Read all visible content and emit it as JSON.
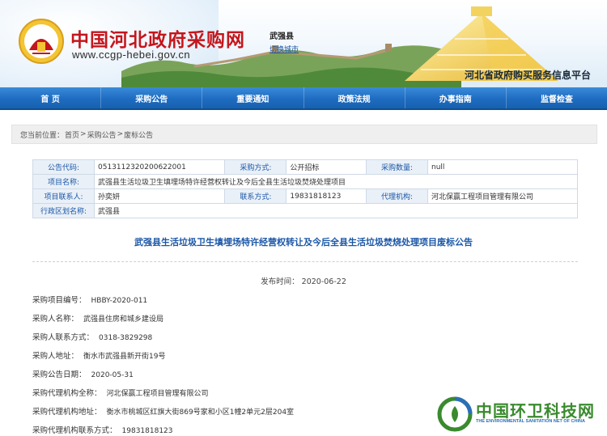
{
  "header": {
    "site_title": "中国河北政府采购网",
    "site_url": "www.ccgp-hebei.gov.cn",
    "region_name": "武强县",
    "switch_city": "切换城市",
    "platform_name": "河北省政府购买服务信息平台"
  },
  "nav": {
    "items": [
      "首 页",
      "采购公告",
      "重要通知",
      "政策法规",
      "办事指南",
      "监督检查"
    ]
  },
  "breadcrumb": {
    "prefix": "您当前位置：",
    "items": [
      "首页",
      "采购公告",
      "废标公告"
    ],
    "separator": ">"
  },
  "info": {
    "code_label": "公告代码:",
    "code_value": "0513112320200622001",
    "method_label": "采购方式:",
    "method_value": "公开招标",
    "quantity_label": "采购数量:",
    "quantity_value": "null",
    "project_label": "项目名称:",
    "project_value": "武强县生活垃圾卫生填埋场特许经营权转让及今后全县生活垃圾焚烧处理项目",
    "contact_label": "项目联系人:",
    "contact_value": "孙奕妍",
    "phone_label": "联系方式:",
    "phone_value": "19831818123",
    "agency_label": "代理机构:",
    "agency_value": "河北保赢工程项目管理有限公司",
    "district_label": "行政区划名称:",
    "district_value": "武强县"
  },
  "article": {
    "title": "武强县生活垃圾卫生填埋场特许经营权转让及今后全县生活垃圾焚烧处理项目废标公告",
    "publish_label": "发布时间：",
    "publish_date": "2020-06-22",
    "fields": [
      {
        "k": "采购项目编号：",
        "v": "HBBY-2020-011"
      },
      {
        "k": "采购人名称：",
        "v": "武强县住房和城乡建设局"
      },
      {
        "k": "采购人联系方式：",
        "v": "0318-3829298"
      },
      {
        "k": "采购人地址：",
        "v": "衡水市武强县新开街19号"
      },
      {
        "k": "采购公告日期：",
        "v": "2020-05-31"
      },
      {
        "k": "采购代理机构全称：",
        "v": "河北保赢工程项目管理有限公司"
      },
      {
        "k": "采购代理机构地址：",
        "v": "衡水市桃城区红旗大街869号家和小区1幢2单元2层204室"
      },
      {
        "k": "采购代理机构联系方式：",
        "v": "19831818123"
      }
    ]
  },
  "watermark": {
    "text": "中国环卫科技网",
    "sub": "THE ENVIRONMENTAL SANITATION NET OF CHINA"
  },
  "colors": {
    "brand_red": "#c4161c",
    "nav_blue": "#1e6cc1",
    "link_blue": "#1a56a6",
    "watermark_green": "#3a8a2e"
  }
}
